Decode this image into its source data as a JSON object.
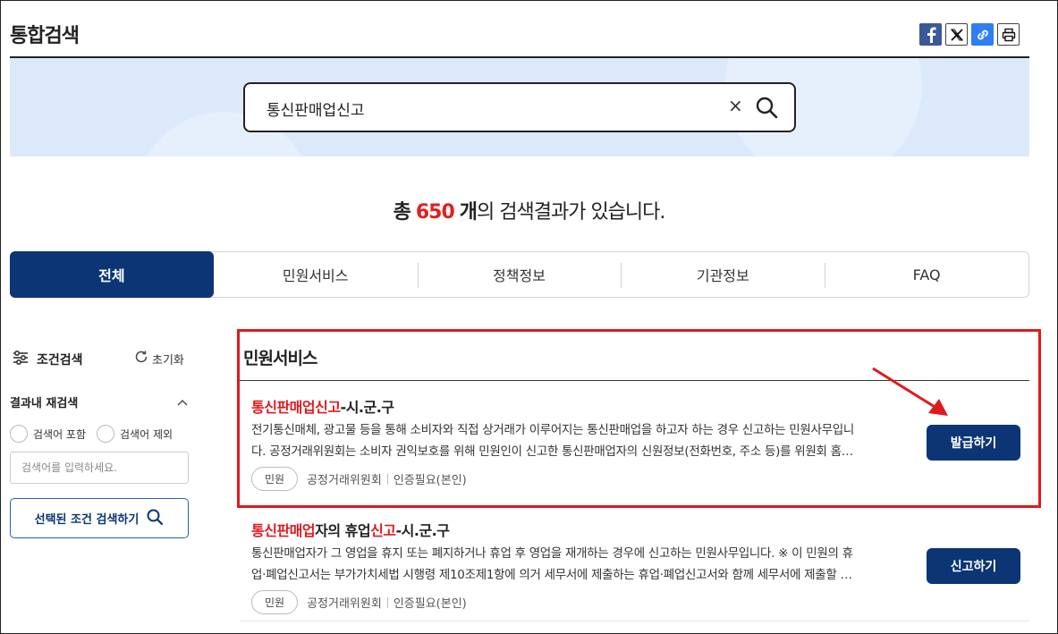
{
  "page": {
    "title": "통합검색"
  },
  "share": {
    "icons": [
      "facebook-icon",
      "x-icon",
      "link-icon",
      "print-icon"
    ]
  },
  "search": {
    "value": "통신판매업신고",
    "clear_label": "×"
  },
  "summary": {
    "prefix": "총",
    "count": "650",
    "unit": "개",
    "suffix": "의 검색결과가 있습니다."
  },
  "tabs": [
    {
      "label": "전체",
      "active": true
    },
    {
      "label": "민원서비스",
      "active": false
    },
    {
      "label": "정책정보",
      "active": false
    },
    {
      "label": "기관정보",
      "active": false
    },
    {
      "label": "FAQ",
      "active": false
    }
  ],
  "filter": {
    "title": "조건검색",
    "reset_label": "초기화",
    "refine_title": "결과내 재검색",
    "include_label": "검색어 포함",
    "exclude_label": "검색어 제외",
    "input_placeholder": "검색어를 입력하세요.",
    "apply_label": "선택된 조건 검색하기"
  },
  "results": {
    "section_title": "민원서비스",
    "items": [
      {
        "name_hl": "통신판매업신고",
        "name_rest": "-시.군.구",
        "desc_line1": "전기통신매체, 광고물 등을 통해 소비자와 직접 상거래가 이루어지는 통신판매업을 하고자 하는 경우 신고하는 민원사무입니",
        "desc_line2": "다. 공정거래위원회는 소비자 권익보호를 위해 민원인이 신고한 통신판매업자의 신원정보(전화번호, 주소 등)를 위원회 홈…",
        "badge": "민원",
        "agency": "공정거래위원회",
        "auth": "인증필요(본인)",
        "action_label": "발급하기"
      },
      {
        "name_hl1": "통신판매업",
        "name_mid": "자의 휴업",
        "name_hl2": "신고",
        "name_rest": "-시.군.구",
        "desc_line1": "통신판매업자가 그 영업을 휴지 또는 폐지하거나 휴업 후 영업을 재개하는 경우에 신고하는 민원사무입니다. ※ 이 민원의 휴",
        "desc_line2": "업·폐업신고서는 부가가치세법 시행령 제10조제1항에 의거 세무서에 제출하는 휴업·폐업신고서와 함께 세무서에 제출할 …",
        "badge": "민원",
        "agency": "공정거래위원회",
        "auth": "인증필요(본인)",
        "action_label": "신고하기"
      }
    ]
  },
  "colors": {
    "brand": "#0b3574",
    "highlight": "#e0191e",
    "band": "#dbe9fb"
  }
}
